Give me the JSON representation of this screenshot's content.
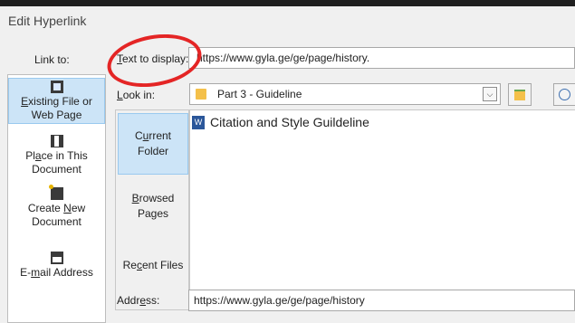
{
  "dialog": {
    "title": "Edit Hyperlink",
    "link_to_label": "Link to:",
    "text_to_display_label": "Text to display:",
    "text_to_display_value": "https://www.gyla.ge/ge/page/history.",
    "look_in_label": "Look in:",
    "look_in_value": "Part 3 - Guideline",
    "address_label": "Address:",
    "address_value": "https://www.gyla.ge/ge/page/history"
  },
  "link_to": {
    "items": [
      {
        "line1": "Existing File or",
        "line2": "Web Page",
        "icon": "existing-file-icon",
        "selected": true
      },
      {
        "line1": "Place in This",
        "line2": "Document",
        "icon": "place-in-document-icon",
        "selected": false
      },
      {
        "line1": "Create New",
        "line2": "Document",
        "icon": "create-new-document-icon",
        "selected": false
      },
      {
        "line1": "E-mail Address",
        "line2": "",
        "icon": "email-address-icon",
        "selected": false
      }
    ]
  },
  "places": {
    "items": [
      {
        "line1": "Current",
        "line2": "Folder",
        "selected": true
      },
      {
        "line1": "Browsed",
        "line2": "Pages",
        "selected": false
      },
      {
        "line1": "Recent Files",
        "line2": "",
        "selected": false
      }
    ]
  },
  "files": [
    {
      "name": "Citation and Style Guildeline",
      "icon": "word-document-icon"
    }
  ],
  "colors": {
    "selection": "#cce4f7",
    "annotation": "#e42525",
    "folder": "#f4c04a",
    "word": "#2b579a"
  }
}
